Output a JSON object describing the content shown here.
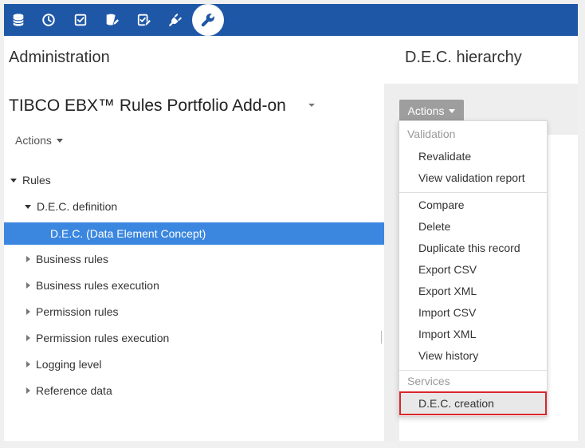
{
  "toolbar": {
    "icons": [
      {
        "name": "database-icon"
      },
      {
        "name": "clock-icon"
      },
      {
        "name": "checkbox-icon"
      },
      {
        "name": "database-edit-icon"
      },
      {
        "name": "checklist-edit-icon"
      },
      {
        "name": "plug-icon"
      },
      {
        "name": "wrench-icon",
        "active": true
      }
    ],
    "color": "#1f57a7"
  },
  "left": {
    "title": "Administration",
    "product": "TIBCO EBX™ Rules Portfolio Add-on",
    "actions_label": "Actions",
    "tree": [
      {
        "label": "Rules",
        "state": "open",
        "level": 0
      },
      {
        "label": "D.E.C. definition",
        "state": "open",
        "level": 1
      },
      {
        "label": "D.E.C. (Data Element Concept)",
        "state": "leaf",
        "level": 2,
        "selected": true
      },
      {
        "label": "Business rules",
        "state": "closed",
        "level": 1
      },
      {
        "label": "Business rules execution",
        "state": "closed",
        "level": 1
      },
      {
        "label": "Permission rules",
        "state": "closed",
        "level": 1
      },
      {
        "label": "Permission rules execution",
        "state": "closed",
        "level": 1
      },
      {
        "label": "Logging level",
        "state": "closed",
        "level": 1
      },
      {
        "label": "Reference data",
        "state": "closed",
        "level": 1
      }
    ]
  },
  "right": {
    "title": "D.E.C. hierarchy",
    "actions_label": "Actions",
    "menu": {
      "validation_header": "Validation",
      "validation_items": [
        "Revalidate",
        "View validation report"
      ],
      "record_items": [
        "Compare",
        "Delete",
        "Duplicate this record",
        "Export CSV",
        "Export XML",
        "Import CSV",
        "Import XML",
        "View history"
      ],
      "services_header": "Services",
      "services_items": [
        "D.E.C. creation"
      ]
    }
  },
  "colors": {
    "selected_row": "#3b87e0",
    "highlight_border": "#d9262c"
  }
}
